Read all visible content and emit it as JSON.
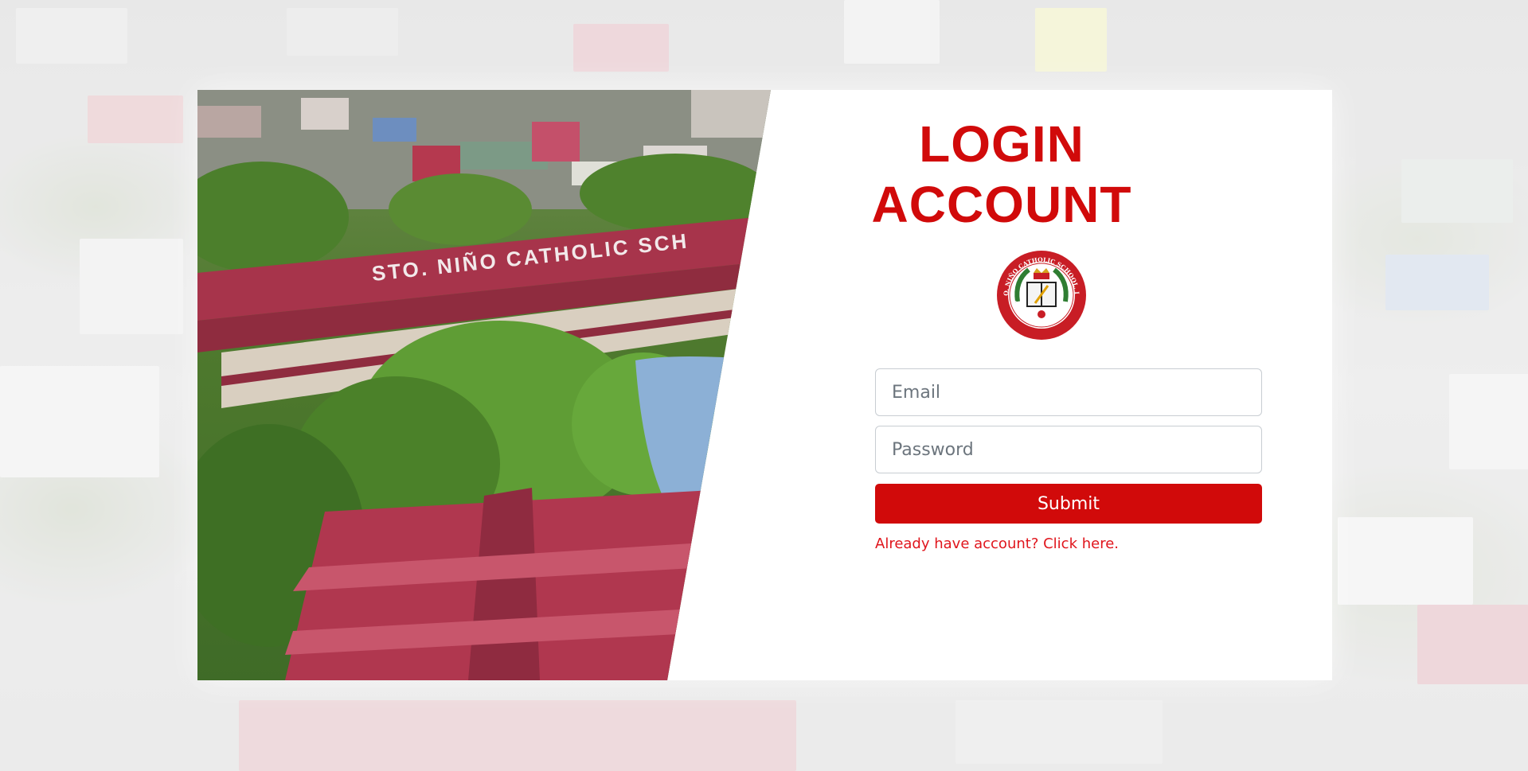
{
  "page": {
    "title_line1": "LOGIN",
    "title_line2": "ACCOUNT"
  },
  "photo": {
    "roof_sign": "STO. NIÑO CATHOLIC SCH"
  },
  "logo": {
    "ring_text": "STO. NIÑO CATHOLIC SCHOOL, INC",
    "bottom_text": "SIGNAL VILLAGE, TAGUIG CITY"
  },
  "form": {
    "email_placeholder": "Email",
    "password_placeholder": "Password",
    "submit_label": "Submit",
    "account_link": "Already have account? Click here."
  },
  "colors": {
    "accent": "#d10a0a",
    "link": "#e0151c",
    "roof": "#a7344b",
    "foliage": "#4f8a2a"
  }
}
